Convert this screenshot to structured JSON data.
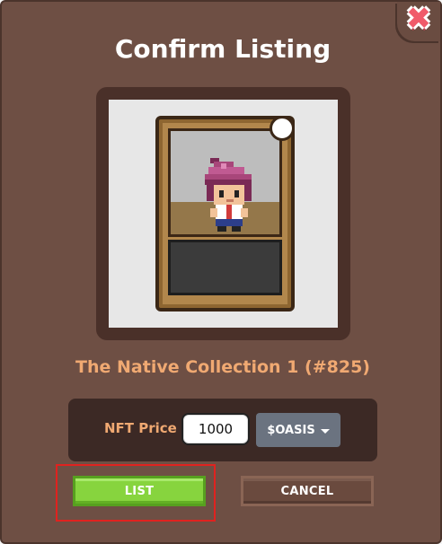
{
  "dialog": {
    "title": "Confirm Listing",
    "close_icon": "close-x-icon"
  },
  "nft": {
    "name": "The Native Collection 1 (#825)"
  },
  "price": {
    "label": "NFT Price",
    "value": "1000",
    "currency": "$OASIS"
  },
  "buttons": {
    "list_label": "LIST",
    "cancel_label": "CANCEL"
  },
  "colors": {
    "dialog_bg": "#6e4f44",
    "accent_text": "#f0a972",
    "list_button": "#87d43e",
    "cancel_button": "#6a4a3e",
    "highlight": "#e0221f"
  }
}
